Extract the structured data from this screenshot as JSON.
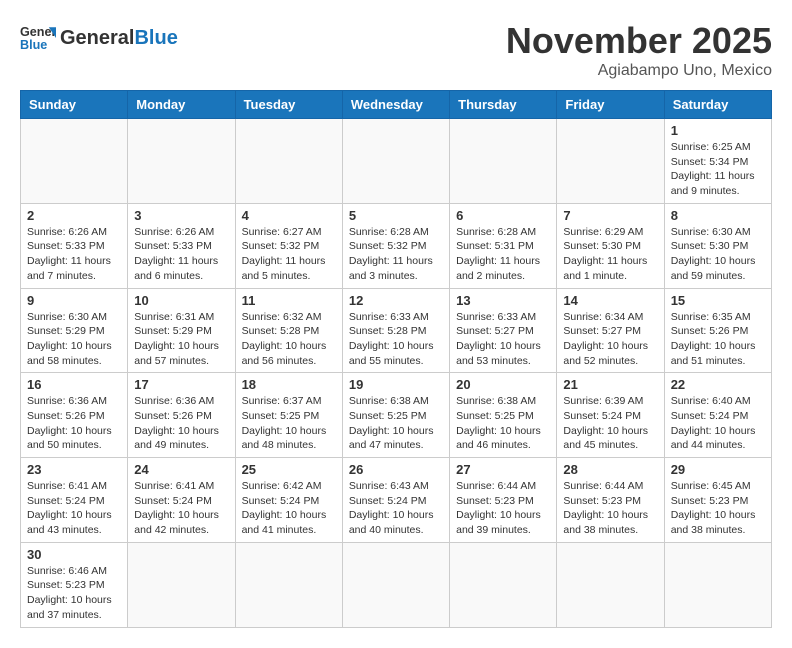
{
  "header": {
    "logo_general": "General",
    "logo_blue": "Blue",
    "month_title": "November 2025",
    "location": "Agiabampo Uno, Mexico"
  },
  "days_of_week": [
    "Sunday",
    "Monday",
    "Tuesday",
    "Wednesday",
    "Thursday",
    "Friday",
    "Saturday"
  ],
  "weeks": [
    [
      {
        "day": "",
        "info": ""
      },
      {
        "day": "",
        "info": ""
      },
      {
        "day": "",
        "info": ""
      },
      {
        "day": "",
        "info": ""
      },
      {
        "day": "",
        "info": ""
      },
      {
        "day": "",
        "info": ""
      },
      {
        "day": "1",
        "info": "Sunrise: 6:25 AM\nSunset: 5:34 PM\nDaylight: 11 hours and 9 minutes."
      }
    ],
    [
      {
        "day": "2",
        "info": "Sunrise: 6:26 AM\nSunset: 5:33 PM\nDaylight: 11 hours and 7 minutes."
      },
      {
        "day": "3",
        "info": "Sunrise: 6:26 AM\nSunset: 5:33 PM\nDaylight: 11 hours and 6 minutes."
      },
      {
        "day": "4",
        "info": "Sunrise: 6:27 AM\nSunset: 5:32 PM\nDaylight: 11 hours and 5 minutes."
      },
      {
        "day": "5",
        "info": "Sunrise: 6:28 AM\nSunset: 5:32 PM\nDaylight: 11 hours and 3 minutes."
      },
      {
        "day": "6",
        "info": "Sunrise: 6:28 AM\nSunset: 5:31 PM\nDaylight: 11 hours and 2 minutes."
      },
      {
        "day": "7",
        "info": "Sunrise: 6:29 AM\nSunset: 5:30 PM\nDaylight: 11 hours and 1 minute."
      },
      {
        "day": "8",
        "info": "Sunrise: 6:30 AM\nSunset: 5:30 PM\nDaylight: 10 hours and 59 minutes."
      }
    ],
    [
      {
        "day": "9",
        "info": "Sunrise: 6:30 AM\nSunset: 5:29 PM\nDaylight: 10 hours and 58 minutes."
      },
      {
        "day": "10",
        "info": "Sunrise: 6:31 AM\nSunset: 5:29 PM\nDaylight: 10 hours and 57 minutes."
      },
      {
        "day": "11",
        "info": "Sunrise: 6:32 AM\nSunset: 5:28 PM\nDaylight: 10 hours and 56 minutes."
      },
      {
        "day": "12",
        "info": "Sunrise: 6:33 AM\nSunset: 5:28 PM\nDaylight: 10 hours and 55 minutes."
      },
      {
        "day": "13",
        "info": "Sunrise: 6:33 AM\nSunset: 5:27 PM\nDaylight: 10 hours and 53 minutes."
      },
      {
        "day": "14",
        "info": "Sunrise: 6:34 AM\nSunset: 5:27 PM\nDaylight: 10 hours and 52 minutes."
      },
      {
        "day": "15",
        "info": "Sunrise: 6:35 AM\nSunset: 5:26 PM\nDaylight: 10 hours and 51 minutes."
      }
    ],
    [
      {
        "day": "16",
        "info": "Sunrise: 6:36 AM\nSunset: 5:26 PM\nDaylight: 10 hours and 50 minutes."
      },
      {
        "day": "17",
        "info": "Sunrise: 6:36 AM\nSunset: 5:26 PM\nDaylight: 10 hours and 49 minutes."
      },
      {
        "day": "18",
        "info": "Sunrise: 6:37 AM\nSunset: 5:25 PM\nDaylight: 10 hours and 48 minutes."
      },
      {
        "day": "19",
        "info": "Sunrise: 6:38 AM\nSunset: 5:25 PM\nDaylight: 10 hours and 47 minutes."
      },
      {
        "day": "20",
        "info": "Sunrise: 6:38 AM\nSunset: 5:25 PM\nDaylight: 10 hours and 46 minutes."
      },
      {
        "day": "21",
        "info": "Sunrise: 6:39 AM\nSunset: 5:24 PM\nDaylight: 10 hours and 45 minutes."
      },
      {
        "day": "22",
        "info": "Sunrise: 6:40 AM\nSunset: 5:24 PM\nDaylight: 10 hours and 44 minutes."
      }
    ],
    [
      {
        "day": "23",
        "info": "Sunrise: 6:41 AM\nSunset: 5:24 PM\nDaylight: 10 hours and 43 minutes."
      },
      {
        "day": "24",
        "info": "Sunrise: 6:41 AM\nSunset: 5:24 PM\nDaylight: 10 hours and 42 minutes."
      },
      {
        "day": "25",
        "info": "Sunrise: 6:42 AM\nSunset: 5:24 PM\nDaylight: 10 hours and 41 minutes."
      },
      {
        "day": "26",
        "info": "Sunrise: 6:43 AM\nSunset: 5:24 PM\nDaylight: 10 hours and 40 minutes."
      },
      {
        "day": "27",
        "info": "Sunrise: 6:44 AM\nSunset: 5:23 PM\nDaylight: 10 hours and 39 minutes."
      },
      {
        "day": "28",
        "info": "Sunrise: 6:44 AM\nSunset: 5:23 PM\nDaylight: 10 hours and 38 minutes."
      },
      {
        "day": "29",
        "info": "Sunrise: 6:45 AM\nSunset: 5:23 PM\nDaylight: 10 hours and 38 minutes."
      }
    ],
    [
      {
        "day": "30",
        "info": "Sunrise: 6:46 AM\nSunset: 5:23 PM\nDaylight: 10 hours and 37 minutes."
      },
      {
        "day": "",
        "info": ""
      },
      {
        "day": "",
        "info": ""
      },
      {
        "day": "",
        "info": ""
      },
      {
        "day": "",
        "info": ""
      },
      {
        "day": "",
        "info": ""
      },
      {
        "day": "",
        "info": ""
      }
    ]
  ]
}
